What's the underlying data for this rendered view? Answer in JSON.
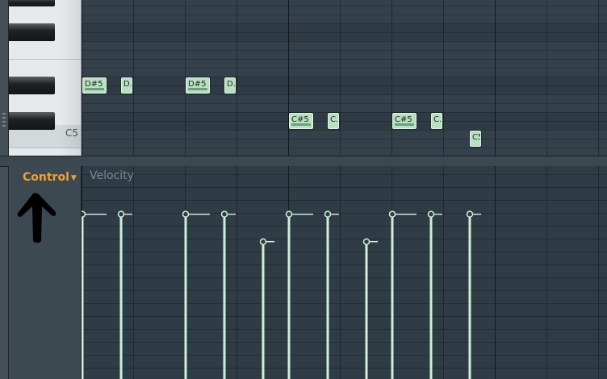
{
  "control": {
    "label": "Control"
  },
  "velocity": {
    "label": "Velocity"
  },
  "keyboard": {
    "c5_label": "C5"
  },
  "notes": [
    {
      "label": "D#5",
      "start": 0,
      "length": 0.5,
      "pitch": "D#5",
      "velocity": 0.78
    },
    {
      "label": "D..",
      "start": 0.75,
      "length": 0.25,
      "pitch": "D#5",
      "velocity": 0.78
    },
    {
      "label": "D#5",
      "start": 2,
      "length": 0.5,
      "pitch": "D#5",
      "velocity": 0.78
    },
    {
      "label": "D..",
      "start": 2.75,
      "length": 0.25,
      "pitch": "D#5",
      "velocity": 0.78
    },
    {
      "label": "C#5",
      "start": 4,
      "length": 0.5,
      "pitch": "C#5",
      "velocity": 0.78
    },
    {
      "label": "C..",
      "start": 4.75,
      "length": 0.25,
      "pitch": "C#5",
      "velocity": 0.78
    },
    {
      "label": "C#5",
      "start": 6,
      "length": 0.5,
      "pitch": "C#5",
      "velocity": 0.78
    },
    {
      "label": "C..",
      "start": 6.75,
      "length": 0.25,
      "pitch": "C#5",
      "velocity": 0.78
    },
    {
      "label": "C5",
      "start": 7.5,
      "length": 0.25,
      "pitch": "C5",
      "velocity": 0.78
    }
  ],
  "extra_velocities": [
    {
      "start": 3.5,
      "velocity": 0.65
    },
    {
      "start": 5.5,
      "velocity": 0.65
    }
  ],
  "colors": {
    "note_fill": "#b8e0c2",
    "velocity_line": "#ccf0d6",
    "accent": "#f0a030"
  }
}
